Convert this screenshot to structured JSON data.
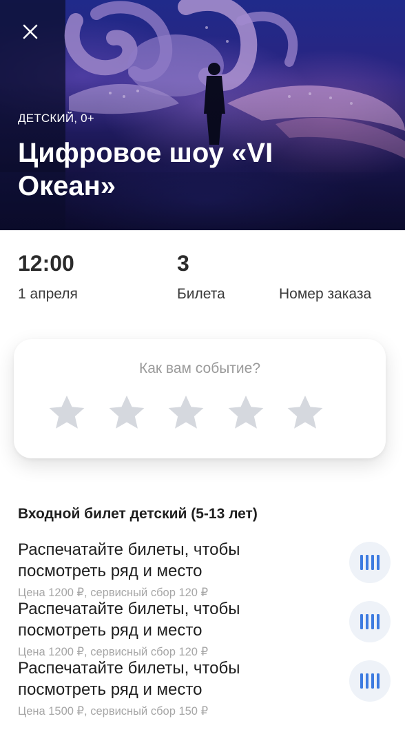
{
  "hero": {
    "category": "ДЕТСКИЙ, 0+",
    "title": "Цифровое шоу «VI Океан»"
  },
  "info": {
    "time": {
      "value": "12:00",
      "label": "1 апреля"
    },
    "tickets": {
      "value": "3",
      "label": "Билета"
    },
    "order": {
      "label": "Номер заказа"
    }
  },
  "rating": {
    "question": "Как вам событие?",
    "stars_total": 5,
    "stars_selected": 0
  },
  "tickets_section": {
    "heading": "Входной билет детский (5-13 лет)",
    "items": [
      {
        "text": "Распечатайте билеты, чтобы посмотреть ряд и место",
        "price": "Цена 1200 ₽, сервисный сбор 120 ₽"
      },
      {
        "text": "Распечатайте билеты, чтобы посмотреть ряд и место",
        "price": "Цена 1200 ₽, сервисный сбор 120 ₽"
      },
      {
        "text": "Распечатайте билеты, чтобы посмотреть ряд и место",
        "price": "Цена 1500 ₽, сервисный сбор 150 ₽"
      }
    ]
  },
  "icons": {
    "close": "close-icon",
    "star": "star-icon",
    "barcode": "barcode-icon"
  },
  "colors": {
    "accent": "#3d7be0",
    "star": "#d5d8de",
    "barcode_bg": "#eef2f8"
  }
}
